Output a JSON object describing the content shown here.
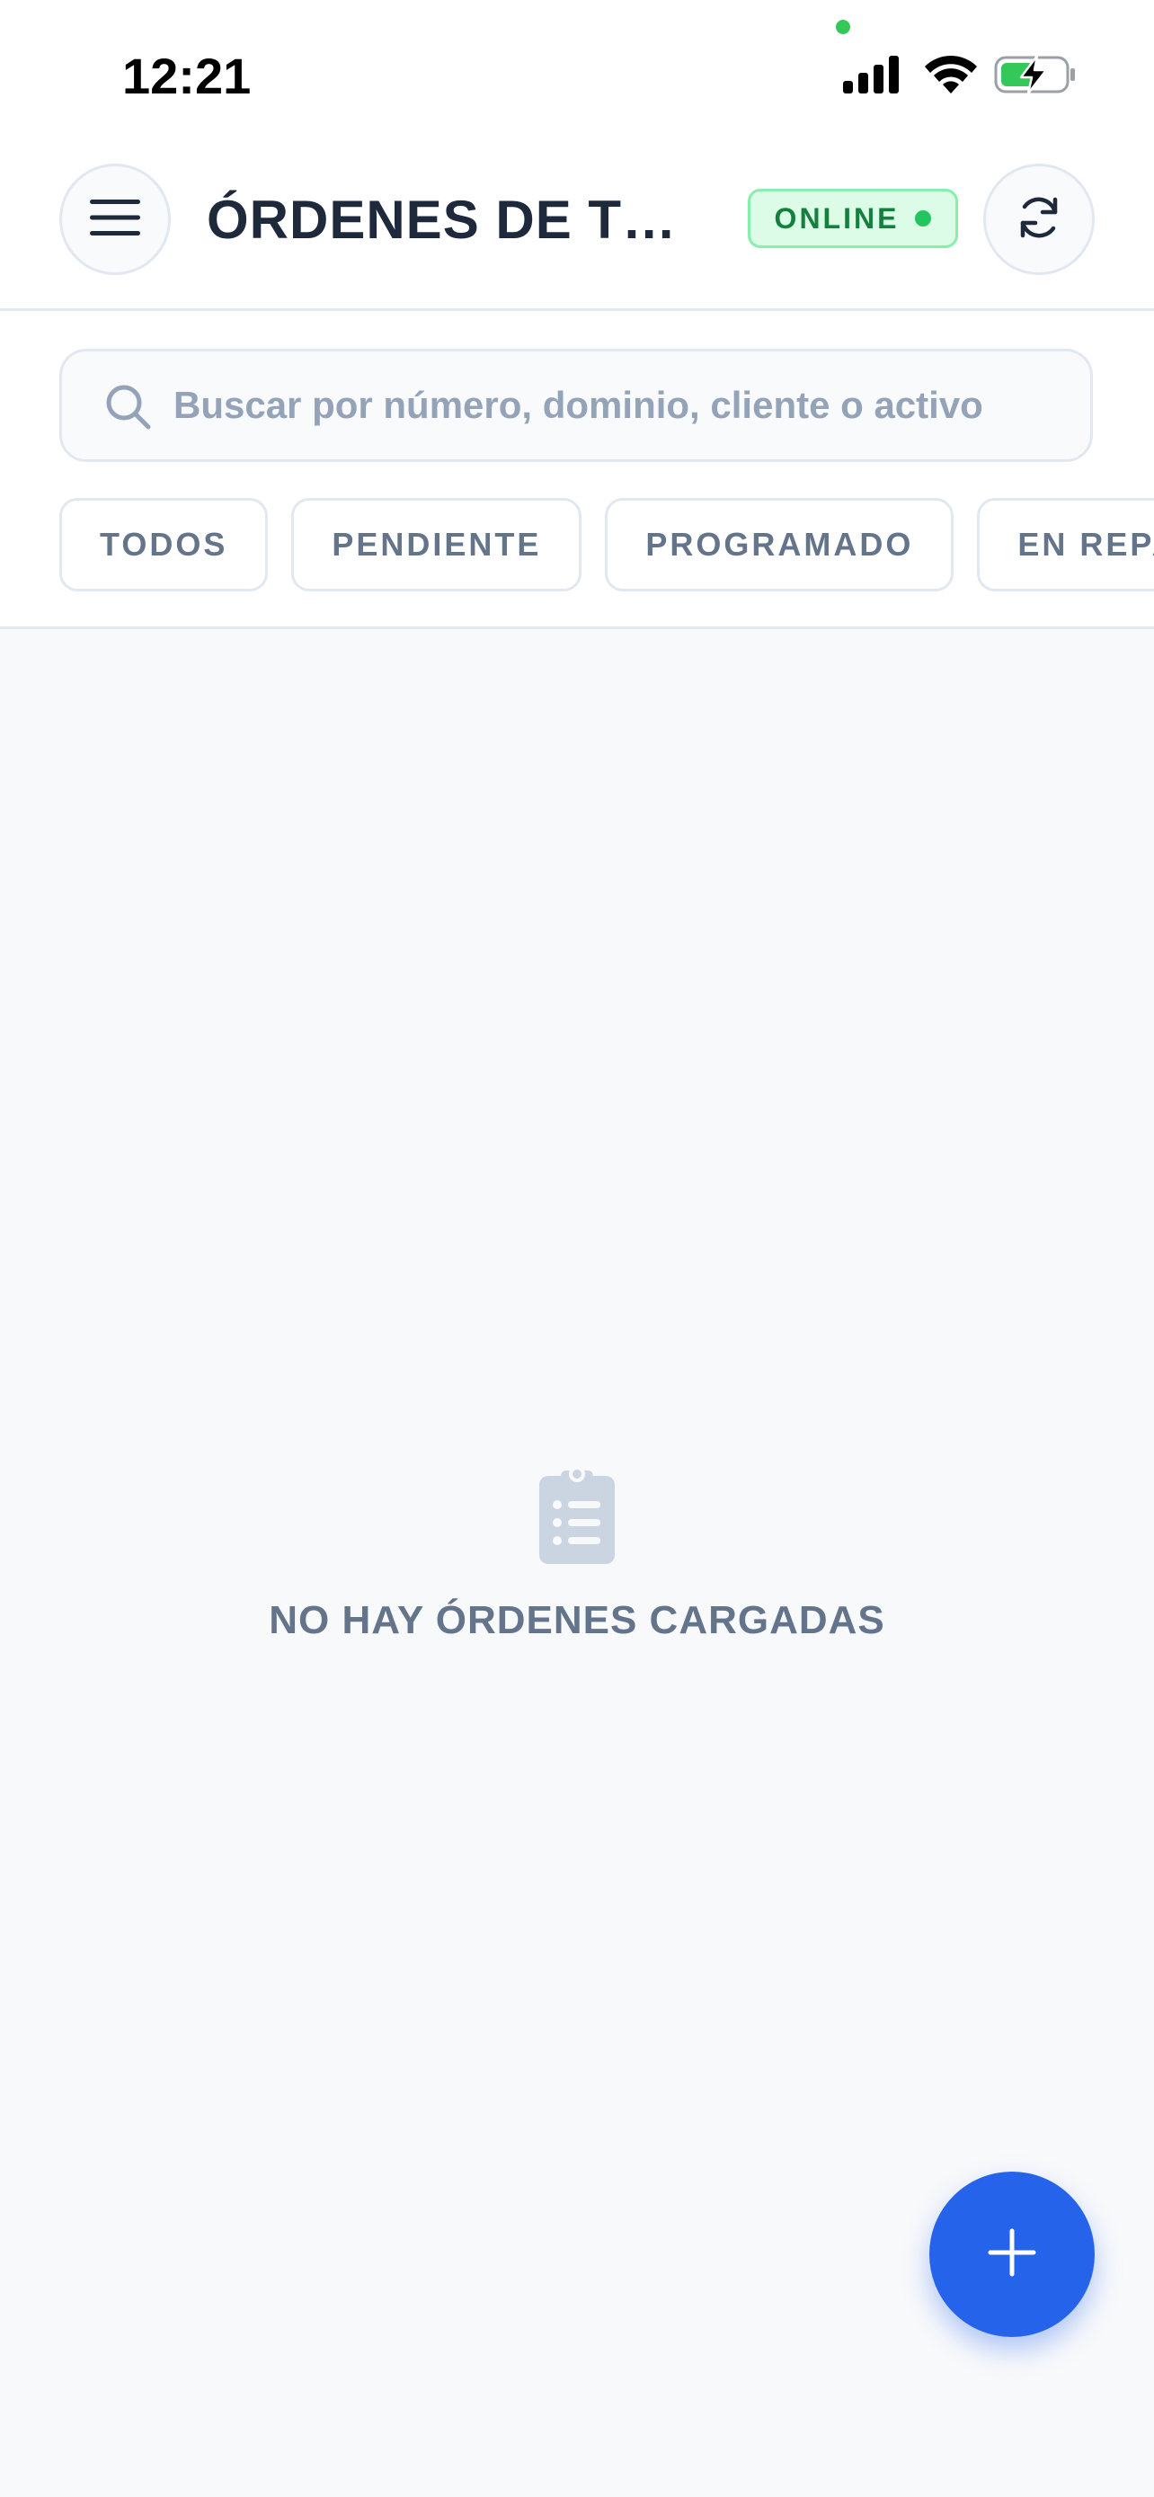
{
  "status_bar": {
    "time": "12:21",
    "icons": [
      "signal-icon",
      "wifi-icon",
      "battery-charging-icon"
    ]
  },
  "header": {
    "title": "ÓRDENES DE TRABAJO",
    "status_badge": "ONLINE",
    "menu_icon": "hamburger-menu-icon",
    "refresh_icon": "refresh-icon"
  },
  "search": {
    "placeholder": "Buscar por número, dominio, cliente o activo",
    "value": ""
  },
  "filters": [
    {
      "label": "TODOS"
    },
    {
      "label": "PENDIENTE"
    },
    {
      "label": "PROGRAMADO"
    },
    {
      "label": "EN REPARACIÓN"
    }
  ],
  "empty_state": {
    "icon": "clipboard-list-icon",
    "message": "NO HAY ÓRDENES CARGADAS"
  },
  "fab": {
    "icon": "plus-icon"
  },
  "colors": {
    "accent": "#2563eb",
    "online": "#15803d",
    "online_bg": "#dcfce7",
    "title": "#1e293b",
    "muted": "#64748b",
    "background": "#f8f9fb"
  }
}
